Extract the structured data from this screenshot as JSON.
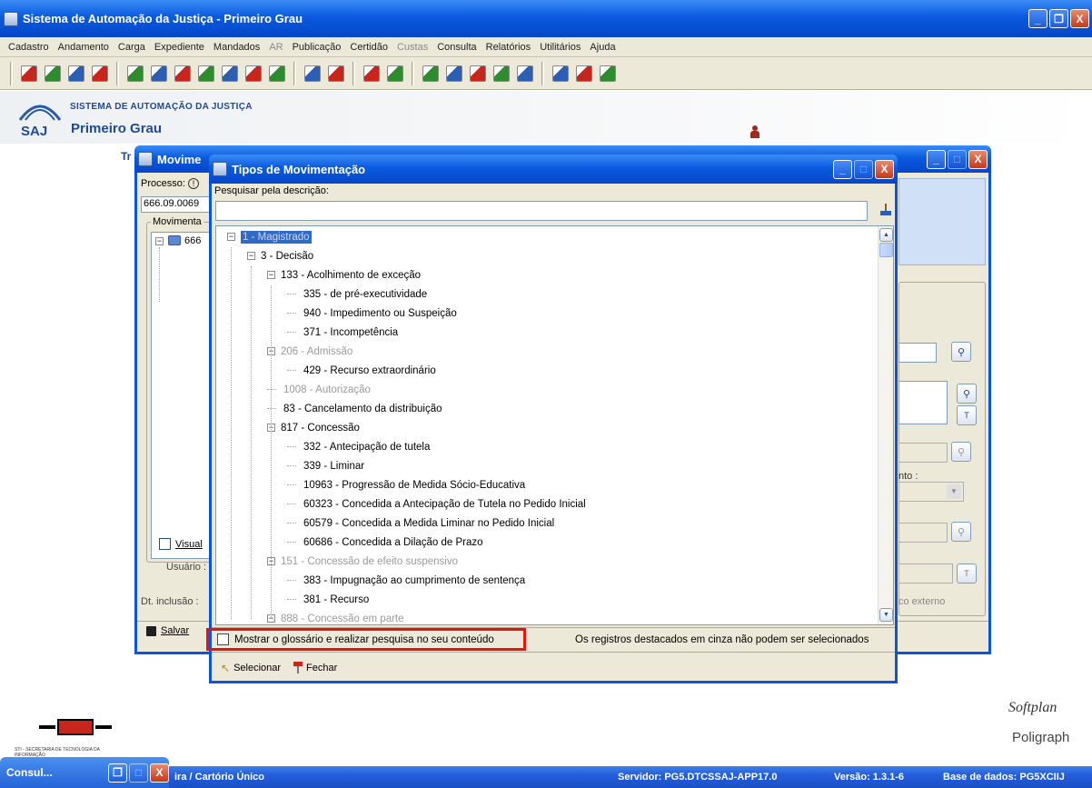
{
  "main_window": {
    "title": "Sistema de Automação da Justiça - Primeiro Grau",
    "min_label": "_",
    "max_label": "❐",
    "close_label": "X"
  },
  "menubar": {
    "items": [
      {
        "label": "Cadastro",
        "enabled": true
      },
      {
        "label": "Andamento",
        "enabled": true
      },
      {
        "label": "Carga",
        "enabled": true
      },
      {
        "label": "Expediente",
        "enabled": true
      },
      {
        "label": "Mandados",
        "enabled": true
      },
      {
        "label": "AR",
        "enabled": false
      },
      {
        "label": "Publicação",
        "enabled": true
      },
      {
        "label": "Certidão",
        "enabled": true
      },
      {
        "label": "Custas",
        "enabled": false
      },
      {
        "label": "Consulta",
        "enabled": true
      },
      {
        "label": "Relatórios",
        "enabled": true
      },
      {
        "label": "Utilitários",
        "enabled": true
      },
      {
        "label": "Ajuda",
        "enabled": true
      }
    ]
  },
  "toolbar": {
    "groups": [
      [
        "pin-icon",
        "scissors-icon",
        "scissors-alt-icon",
        "people-icon"
      ],
      [
        "doc-copy-icon",
        "doc-edit-icon",
        "doc-search-icon",
        "doc-list-icon",
        "doc-user-icon",
        "doc-arrow-icon",
        "grid-icon"
      ],
      [
        "doc-go-icon",
        "doc-export-icon"
      ],
      [
        "arrow-right-icon",
        "people-group-icon"
      ],
      [
        "page-icon",
        "page-gray-icon",
        "page-stack-icon",
        "magnifier-page-icon",
        "hand-text-icon"
      ],
      [
        "doc-zoom-icon",
        "doc-zoom2-icon",
        "doc-zoom3-icon"
      ]
    ],
    "colors": {
      "red": "#c8261c",
      "green": "#2e8b2e",
      "blue": "#2c5fb4"
    }
  },
  "app_header": {
    "org_line": "SISTEMA DE AUTOMAÇÃO DA JUSTIÇA",
    "logo_text": "SAJ",
    "subtitle": "Primeiro Grau"
  },
  "background_label": "Tr",
  "mov_window": {
    "title": "Movime",
    "processo_label": "Processo:",
    "processo_value": "666.09.0069",
    "group_label": "Movimenta",
    "tree_root_label": "666",
    "visualizar_label": "Visual",
    "usuario_label": "Usuário :",
    "dt_inclusao_label": "Dt. inclusão :",
    "salvar_label": "Salvar",
    "right_label_1": "nto :",
    "right_label_2": "co externo"
  },
  "dialog": {
    "title": "Tipos de Movimentação",
    "search_label": "Pesquisar pela descrição:",
    "search_value": "",
    "tree": [
      {
        "depth": 0,
        "label": "1 - Magistrado",
        "expander": "−",
        "selected": true,
        "gray": false
      },
      {
        "depth": 1,
        "label": "3 - Decisão",
        "expander": "−",
        "selected": false,
        "gray": false
      },
      {
        "depth": 2,
        "label": "133 - Acolhimento de exceção",
        "expander": "−",
        "selected": false,
        "gray": false
      },
      {
        "depth": 3,
        "label": "335 - de pré-executividade",
        "expander": "",
        "selected": false,
        "gray": false
      },
      {
        "depth": 3,
        "label": "940 - Impedimento ou Suspeição",
        "expander": "",
        "selected": false,
        "gray": false
      },
      {
        "depth": 3,
        "label": "371 - Incompetência",
        "expander": "",
        "selected": false,
        "gray": false
      },
      {
        "depth": 2,
        "label": "206 - Admissão",
        "expander": "−",
        "selected": false,
        "gray": true
      },
      {
        "depth": 3,
        "label": "429 - Recurso extraordinário",
        "expander": "",
        "selected": false,
        "gray": false
      },
      {
        "depth": 2,
        "label": "1008 - Autorização",
        "expander": "",
        "selected": false,
        "gray": true
      },
      {
        "depth": 2,
        "label": "83 - Cancelamento da distribuição",
        "expander": "",
        "selected": false,
        "gray": false
      },
      {
        "depth": 2,
        "label": "817 - Concessão",
        "expander": "−",
        "selected": false,
        "gray": false
      },
      {
        "depth": 3,
        "label": "332 - Antecipação de tutela",
        "expander": "",
        "selected": false,
        "gray": false
      },
      {
        "depth": 3,
        "label": "339 - Liminar",
        "expander": "",
        "selected": false,
        "gray": false
      },
      {
        "depth": 3,
        "label": "10963 - Progressão de Medida Sócio-Educativa",
        "expander": "",
        "selected": false,
        "gray": false
      },
      {
        "depth": 3,
        "label": "60323 - Concedida a Antecipação de Tutela no Pedido Inicial",
        "expander": "",
        "selected": false,
        "gray": false
      },
      {
        "depth": 3,
        "label": "60579 - Concedida a Medida Liminar no Pedido Inicial",
        "expander": "",
        "selected": false,
        "gray": false
      },
      {
        "depth": 3,
        "label": "60686 - Concedida a Dilação de Prazo",
        "expander": "",
        "selected": false,
        "gray": false
      },
      {
        "depth": 2,
        "label": "151 - Concessão de efeito suspensivo",
        "expander": "−",
        "selected": false,
        "gray": true
      },
      {
        "depth": 3,
        "label": "383 - Impugnação ao cumprimento de sentença",
        "expander": "",
        "selected": false,
        "gray": false
      },
      {
        "depth": 3,
        "label": "381 - Recurso",
        "expander": "",
        "selected": false,
        "gray": false
      },
      {
        "depth": 2,
        "label": "888 - Concessão em parte",
        "expander": "−",
        "selected": false,
        "gray": true
      }
    ],
    "glossary_checkbox_label": "Mostrar o glossário e realizar pesquisa no seu conteúdo",
    "gray_note": "Os registros destacados em cinza não podem ser selecionados",
    "select_label": "Selecionar",
    "close_label": "Fechar",
    "highlight_color": "#e8140c"
  },
  "footer_logos": {
    "sti_text": "STI - SECRETARIA DE TECNOLOGIA DA INFORMAÇÃO",
    "softplan_text": "Softplan",
    "poligraph_text": "Poligraph"
  },
  "taskbar": {
    "task_label": "Consul...",
    "location": "ira / Cartório Único",
    "servidor": "Servidor: PG5.DTCSSAJ-APP17.0",
    "versao": "Versão: 1.3.1-6",
    "base": "Base de dados: PG5XCIIJ"
  }
}
